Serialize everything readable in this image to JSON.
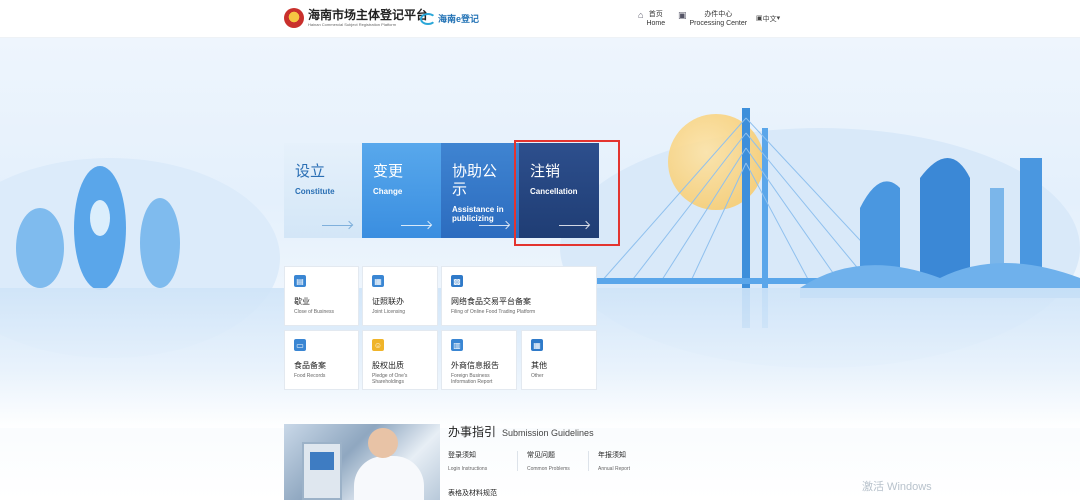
{
  "header": {
    "logo_cn": "海南市场主体登记平台",
    "logo_en": "Hainan Commercial Subject Registration Platform",
    "elogo_text": "海南e登记",
    "nav": [
      {
        "icon": "home-icon",
        "label_cn": "首页",
        "label_en": "Home"
      },
      {
        "icon": "building-icon",
        "label_cn": "办件中心",
        "label_en": "Processing Center"
      }
    ],
    "lang": "中文"
  },
  "tiles": [
    {
      "cn": "设立",
      "en": "Constitute"
    },
    {
      "cn": "变更",
      "en": "Change"
    },
    {
      "cn": "协助公示",
      "en": "Assistance in publicizing"
    },
    {
      "cn": "注销",
      "en": "Cancellation"
    }
  ],
  "services": [
    {
      "cn": "歇业",
      "en": "Close of Business"
    },
    {
      "cn": "证照联办",
      "en": "Joint Licensing"
    },
    {
      "cn": "网络食品交易平台备案",
      "en": "Filing of Online Food Trading Platform"
    },
    {
      "cn": "食品备案",
      "en": "Food Records"
    },
    {
      "cn": "股权出质",
      "en": "Pledge of One's Shareholdings"
    },
    {
      "cn": "外商信息报告",
      "en": "Foreign Business Information Report"
    },
    {
      "cn": "其他",
      "en": "Other"
    }
  ],
  "guidelines": {
    "title_cn": "办事指引",
    "title_en": "Submission Guidelines",
    "items": [
      {
        "cn": "登录须知",
        "en": "Login Instructions"
      },
      {
        "cn": "常见问题",
        "en": "Common Problems"
      },
      {
        "cn": "年报须知",
        "en": "Annual Report"
      }
    ],
    "more": "表格及材料规范"
  },
  "watermark": "激活 Windows",
  "colors": {
    "tile_constitute": "#d3e6f7",
    "tile_change": "#3a8ee0",
    "tile_assist": "#2c6cbf",
    "tile_cancel": "#1f3d74",
    "highlight": "#e3342f"
  }
}
